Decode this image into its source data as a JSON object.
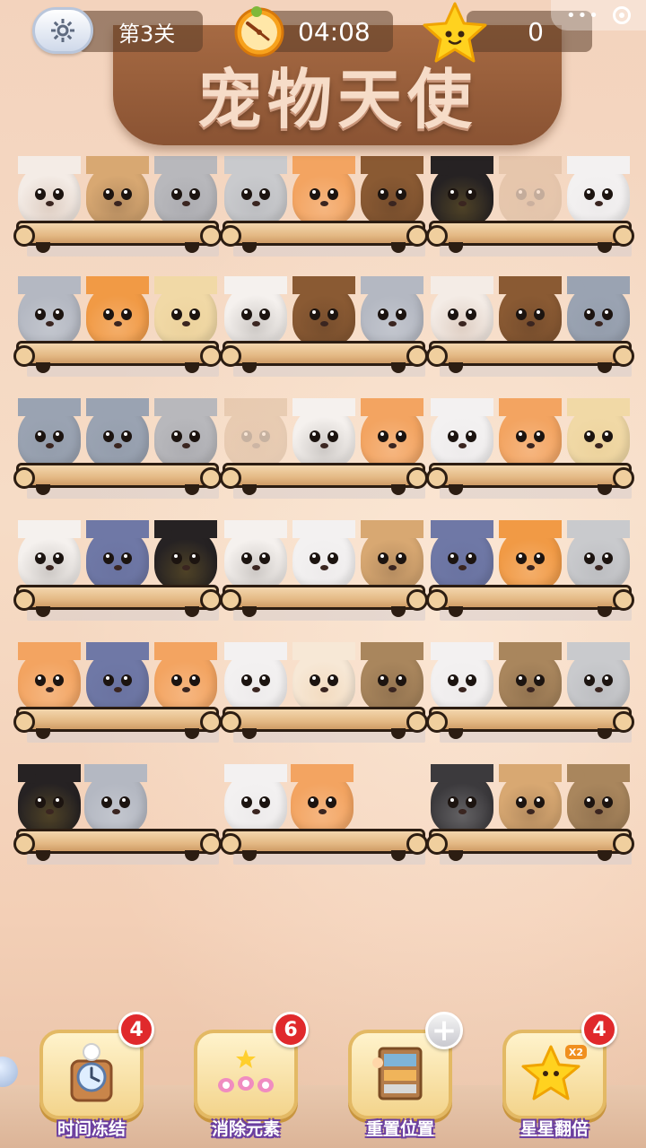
{
  "header": {
    "level_label": "第3关",
    "timer": "04:08",
    "star_count": "0",
    "title": "宠物天使",
    "menu_dots": "•••"
  },
  "icons": {
    "settings": "gear-icon",
    "timer": "clock-icon",
    "stars": "star-icon",
    "menu_close": "close-circle-icon"
  },
  "shelves": [
    {
      "pets": [
        {
          "kind": "shih-tzu-puppy",
          "color": "#f4ece6",
          "accent": "#8a5a3b",
          "faded": false
        },
        {
          "kind": "pug",
          "color": "#d8a872",
          "accent": "#2b1d16",
          "faded": false
        },
        {
          "kind": "grey-tabby-cat",
          "color": "#b8b8bc",
          "accent": "#7f7f86",
          "faded": false
        }
      ]
    },
    {
      "pets": [
        {
          "kind": "grey-white-cat",
          "color": "#c9cacd",
          "accent": "#8c8d92",
          "faded": false
        },
        {
          "kind": "orange-white-cat",
          "color": "#f3a461",
          "accent": "#ffffff",
          "faded": false
        },
        {
          "kind": "yorkie",
          "color": "#8a5a33",
          "accent": "#2a1d15",
          "faded": false
        }
      ]
    },
    {
      "pets": [
        {
          "kind": "black-labrador",
          "color": "#262223",
          "accent": "#f1c232",
          "faded": false
        },
        {
          "kind": "faded-dog",
          "color": "#b68a60",
          "accent": "#6e4d33",
          "faded": true
        },
        {
          "kind": "white-cat",
          "color": "#f3f1f1",
          "accent": "#d8d4d6",
          "faded": false
        }
      ]
    },
    {
      "pets": [
        {
          "kind": "grey-sheepdog",
          "color": "#b4b8c2",
          "accent": "#ffffff",
          "faded": false
        },
        {
          "kind": "orange-tabby-cat",
          "color": "#f19a45",
          "accent": "#ffffff",
          "faded": false
        },
        {
          "kind": "golden-puppy",
          "color": "#f1d9a6",
          "accent": "#d8b87a",
          "faded": false
        }
      ]
    },
    {
      "pets": [
        {
          "kind": "calico-cat",
          "color": "#f5f1ee",
          "accent": "#2b2622",
          "faded": false
        },
        {
          "kind": "yorkie",
          "color": "#8a5a33",
          "accent": "#2a1d15",
          "faded": false
        },
        {
          "kind": "grey-sheepdog",
          "color": "#b4b8c2",
          "accent": "#ffffff",
          "faded": false
        }
      ]
    },
    {
      "pets": [
        {
          "kind": "shih-tzu-puppy",
          "color": "#f4ece6",
          "accent": "#8a5a3b",
          "faded": false
        },
        {
          "kind": "yorkie",
          "color": "#8a5a33",
          "accent": "#2a1d15",
          "faded": false
        },
        {
          "kind": "grey-poodle",
          "color": "#9aa3b2",
          "accent": "#7d8694",
          "faded": false
        }
      ]
    },
    {
      "pets": [
        {
          "kind": "grey-poodle",
          "color": "#9aa3b2",
          "accent": "#7d8694",
          "faded": false
        },
        {
          "kind": "grey-poodle",
          "color": "#9aa3b2",
          "accent": "#7d8694",
          "faded": false
        },
        {
          "kind": "grey-tabby-cat",
          "color": "#b8b8bc",
          "accent": "#7f7f86",
          "faded": false
        }
      ]
    },
    {
      "pets": [
        {
          "kind": "faded-dog",
          "color": "#b68a60",
          "accent": "#6e4d33",
          "faded": true
        },
        {
          "kind": "calico-cat",
          "color": "#f5f1ee",
          "accent": "#2b2622",
          "faded": false
        },
        {
          "kind": "orange-white-cat",
          "color": "#f3a461",
          "accent": "#ffffff",
          "faded": false
        }
      ]
    },
    {
      "pets": [
        {
          "kind": "white-cat",
          "color": "#f3f1f1",
          "accent": "#d8d4d6",
          "faded": false
        },
        {
          "kind": "orange-white-cat",
          "color": "#f3a461",
          "accent": "#ffffff",
          "faded": false
        },
        {
          "kind": "golden-puppy",
          "color": "#f1d9a6",
          "accent": "#d8b87a",
          "faded": false
        }
      ]
    },
    {
      "pets": [
        {
          "kind": "calico-cat",
          "color": "#f5f1ee",
          "accent": "#2b2622",
          "faded": false
        },
        {
          "kind": "british-blue-cat",
          "color": "#6f78a6",
          "accent": "#565f8c",
          "faded": false
        },
        {
          "kind": "black-labrador",
          "color": "#262223",
          "accent": "#f1c232",
          "faded": false
        }
      ]
    },
    {
      "pets": [
        {
          "kind": "calico-cat",
          "color": "#f5f1ee",
          "accent": "#2b2622",
          "faded": false
        },
        {
          "kind": "white-cat",
          "color": "#f3f1f1",
          "accent": "#d8d4d6",
          "faded": false
        },
        {
          "kind": "pug",
          "color": "#d8a872",
          "accent": "#2b1d16",
          "faded": false
        }
      ]
    },
    {
      "pets": [
        {
          "kind": "british-blue-cat",
          "color": "#6f78a6",
          "accent": "#565f8c",
          "faded": false
        },
        {
          "kind": "orange-tabby-cat",
          "color": "#f19a45",
          "accent": "#ffffff",
          "faded": false
        },
        {
          "kind": "grey-white-cat",
          "color": "#c9cacd",
          "accent": "#8c8d92",
          "faded": false
        }
      ]
    },
    {
      "pets": [
        {
          "kind": "orange-white-cat",
          "color": "#f3a461",
          "accent": "#ffffff",
          "faded": false
        },
        {
          "kind": "british-blue-cat",
          "color": "#6f78a6",
          "accent": "#565f8c",
          "faded": false
        },
        {
          "kind": "orange-white-cat",
          "color": "#f3a461",
          "accent": "#ffffff",
          "faded": false
        }
      ]
    },
    {
      "pets": [
        {
          "kind": "white-cat",
          "color": "#f3f1f1",
          "accent": "#d8d4d6",
          "faded": false
        },
        {
          "kind": "cream-cat",
          "color": "#f7e8d6",
          "accent": "#e0a868",
          "faded": false
        },
        {
          "kind": "brown-tabby-cat",
          "color": "#a9865d",
          "accent": "#3b2a1d",
          "faded": false
        }
      ]
    },
    {
      "pets": [
        {
          "kind": "white-cat",
          "color": "#f3f1f1",
          "accent": "#d8d4d6",
          "faded": false
        },
        {
          "kind": "brown-tabby-cat",
          "color": "#a9865d",
          "accent": "#3b2a1d",
          "faded": false
        },
        {
          "kind": "grey-white-cat",
          "color": "#c9cacd",
          "accent": "#8c8d92",
          "faded": false
        }
      ]
    },
    {
      "pets": [
        {
          "kind": "black-labrador",
          "color": "#262223",
          "accent": "#f1c232",
          "faded": false
        },
        {
          "kind": "grey-sheepdog",
          "color": "#b4b8c2",
          "accent": "#ffffff",
          "faded": false
        }
      ]
    },
    {
      "pets": [
        {
          "kind": "white-cat",
          "color": "#f3f1f1",
          "accent": "#d8d4d6",
          "faded": false
        },
        {
          "kind": "orange-white-cat",
          "color": "#f3a461",
          "accent": "#ffffff",
          "faded": false
        }
      ]
    },
    {
      "pets": [
        {
          "kind": "husky",
          "color": "#3c3a3d",
          "accent": "#ffffff",
          "faded": false
        },
        {
          "kind": "pug",
          "color": "#d8a872",
          "accent": "#2b1d16",
          "faded": false
        },
        {
          "kind": "brown-tabby-cat",
          "color": "#a9865d",
          "accent": "#3b2a1d",
          "faded": false
        }
      ]
    }
  ],
  "tools": [
    {
      "label": "时间冻结",
      "badge": "4",
      "icon": "alarm-clock-icon"
    },
    {
      "label": "消除元素",
      "badge": "6",
      "icon": "paw-stars-icon"
    },
    {
      "label": "重置位置",
      "badge": "+",
      "icon": "shelf-reset-icon"
    },
    {
      "label": "星星翻倍",
      "badge": "4",
      "icon": "star-x2-icon"
    }
  ],
  "colors": {
    "badge_red": "#e0292c",
    "label_outline": "#6b3fa0",
    "sign_wood": "#8a5333",
    "shelf_wood": "#e4b985"
  }
}
